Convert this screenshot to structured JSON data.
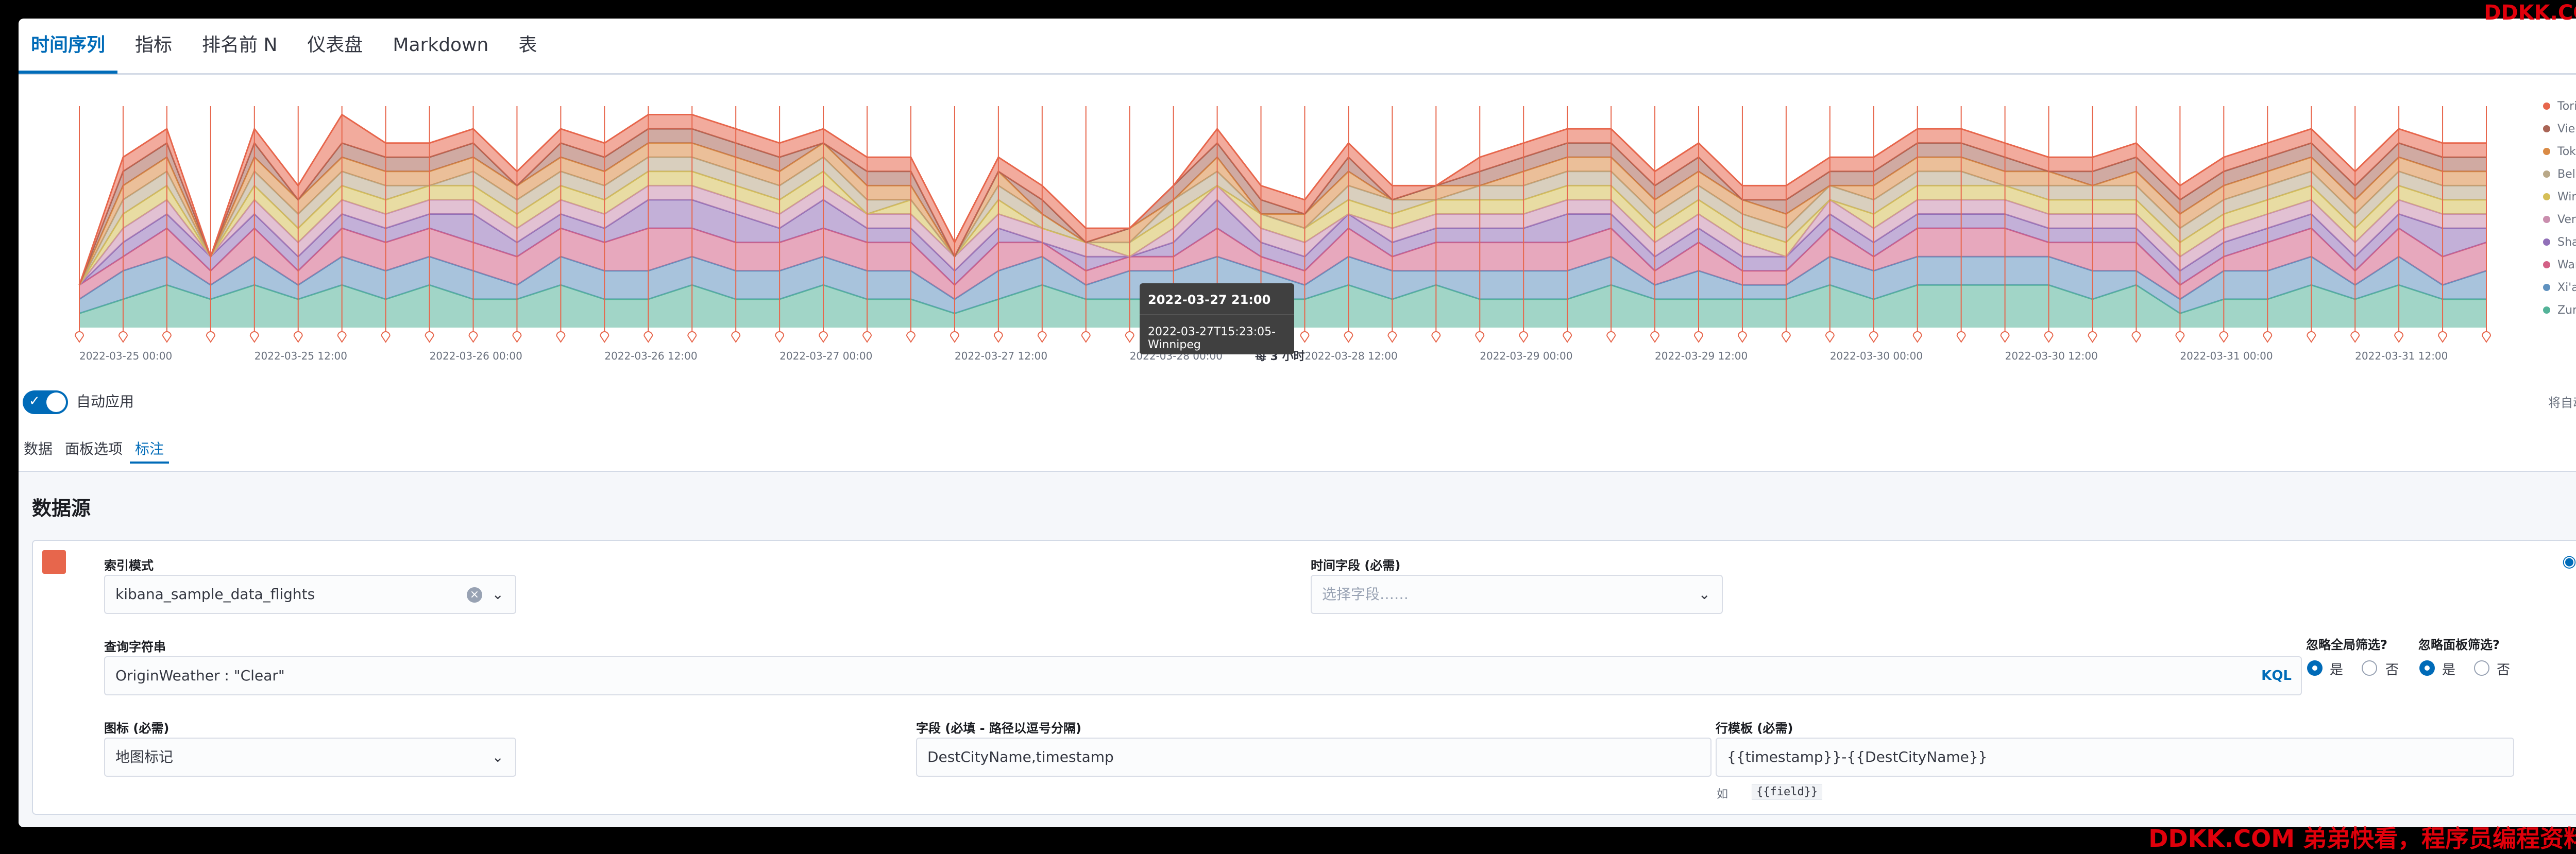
{
  "tabs": [
    {
      "label": "时间序列",
      "active": true
    },
    {
      "label": "指标",
      "active": false
    },
    {
      "label": "排名前 N",
      "active": false
    },
    {
      "label": "仪表盘",
      "active": false
    },
    {
      "label": "Markdown",
      "active": false
    },
    {
      "label": "表",
      "active": false
    }
  ],
  "chart_data": {
    "type": "area",
    "stacked": true,
    "x": [
      "2022-03-25 00:00",
      "2022-03-25 03:00",
      "2022-03-25 06:00",
      "2022-03-25 09:00",
      "2022-03-25 12:00",
      "2022-03-25 15:00",
      "2022-03-25 18:00",
      "2022-03-25 21:00",
      "2022-03-26 00:00",
      "2022-03-26 03:00",
      "2022-03-26 06:00",
      "2022-03-26 09:00",
      "2022-03-26 12:00",
      "2022-03-26 15:00",
      "2022-03-26 18:00",
      "2022-03-26 21:00",
      "2022-03-27 00:00",
      "2022-03-27 03:00",
      "2022-03-27 06:00",
      "2022-03-27 09:00",
      "2022-03-27 12:00",
      "2022-03-27 15:00",
      "2022-03-27 18:00",
      "2022-03-27 21:00",
      "2022-03-28 00:00",
      "2022-03-28 03:00",
      "2022-03-28 06:00",
      "2022-03-28 09:00",
      "2022-03-28 12:00",
      "2022-03-28 15:00",
      "2022-03-28 18:00",
      "2022-03-28 21:00",
      "2022-03-29 00:00",
      "2022-03-29 03:00",
      "2022-03-29 06:00",
      "2022-03-29 09:00",
      "2022-03-29 12:00",
      "2022-03-29 15:00",
      "2022-03-29 18:00",
      "2022-03-29 21:00",
      "2022-03-30 00:00",
      "2022-03-30 03:00",
      "2022-03-30 06:00",
      "2022-03-30 09:00",
      "2022-03-30 12:00",
      "2022-03-30 15:00",
      "2022-03-30 18:00",
      "2022-03-30 21:00",
      "2022-03-31 00:00",
      "2022-03-31 03:00",
      "2022-03-31 06:00",
      "2022-03-31 09:00",
      "2022-03-31 12:00",
      "2022-03-31 15:00",
      "2022-03-31 18:00",
      "2022-03-31 21:00"
    ],
    "x_ticks": [
      "2022-03-25 00:00",
      "2022-03-25 12:00",
      "2022-03-26 00:00",
      "2022-03-26 12:00",
      "2022-03-27 00:00",
      "2022-03-27 12:00",
      "2022-03-28 00:00",
      "2022-03-28 12:00",
      "2022-03-29 00:00",
      "2022-03-29 12:00",
      "2022-03-30 00:00",
      "2022-03-30 12:00",
      "2022-03-31 00:00",
      "2022-03-31 12:00"
    ],
    "xlabel": "每 3 小时",
    "series": [
      {
        "name": "Zurich",
        "color": "#54b399",
        "values": [
          1,
          2,
          3,
          2,
          3,
          2,
          3,
          2,
          3,
          2,
          2,
          3,
          2,
          2,
          3,
          2,
          2,
          3,
          2,
          2,
          1,
          2,
          3,
          2,
          2,
          2,
          3,
          2,
          2,
          3,
          2,
          3,
          2,
          2,
          2,
          3,
          2,
          2,
          2,
          2,
          3,
          2,
          3,
          3,
          3,
          3,
          2,
          3,
          1,
          2,
          2,
          3,
          2,
          3,
          2,
          2
        ]
      },
      {
        "name": "Xi'an",
        "color": "#6092c0",
        "values": [
          1,
          2,
          2,
          1,
          2,
          1,
          2,
          2,
          2,
          2,
          1,
          2,
          2,
          2,
          2,
          2,
          2,
          2,
          2,
          2,
          1,
          2,
          2,
          1,
          2,
          2,
          2,
          2,
          1,
          2,
          2,
          1,
          2,
          2,
          2,
          2,
          1,
          2,
          1,
          1,
          2,
          2,
          2,
          2,
          2,
          2,
          2,
          1,
          1,
          2,
          2,
          2,
          1,
          2,
          1,
          2
        ]
      },
      {
        "name": "Warsaw",
        "color": "#d36086",
        "values": [
          1,
          1,
          2,
          1,
          2,
          1,
          2,
          2,
          2,
          2,
          2,
          2,
          2,
          3,
          2,
          2,
          2,
          2,
          2,
          2,
          1,
          2,
          1,
          1,
          1,
          1,
          2,
          1,
          1,
          2,
          1,
          2,
          2,
          2,
          2,
          2,
          1,
          2,
          1,
          1,
          2,
          1,
          2,
          2,
          2,
          1,
          2,
          2,
          1,
          1,
          2,
          2,
          1,
          2,
          2,
          2
        ]
      },
      {
        "name": "Shanghai",
        "color": "#9170b8",
        "values": [
          0,
          1,
          1,
          1,
          1,
          1,
          1,
          1,
          1,
          2,
          1,
          1,
          1,
          2,
          2,
          2,
          1,
          2,
          1,
          1,
          1,
          1,
          0,
          1,
          0,
          1,
          2,
          1,
          1,
          1,
          1,
          1,
          1,
          1,
          2,
          1,
          1,
          1,
          1,
          1,
          1,
          1,
          1,
          1,
          1,
          1,
          1,
          1,
          1,
          1,
          1,
          1,
          1,
          1,
          2,
          1
        ]
      },
      {
        "name": "Verona",
        "color": "#ca8eae",
        "values": [
          0,
          1,
          1,
          0,
          1,
          1,
          1,
          1,
          1,
          1,
          1,
          1,
          1,
          1,
          1,
          1,
          1,
          1,
          1,
          1,
          1,
          1,
          1,
          1,
          0,
          1,
          1,
          1,
          1,
          0,
          1,
          1,
          1,
          1,
          1,
          1,
          1,
          1,
          1,
          0,
          1,
          1,
          1,
          1,
          1,
          1,
          1,
          1,
          1,
          1,
          1,
          1,
          1,
          1,
          1,
          1
        ]
      },
      {
        "name": "Winnipeg",
        "color": "#d6bf57",
        "values": [
          0,
          1,
          1,
          0,
          1,
          1,
          1,
          1,
          1,
          1,
          1,
          1,
          1,
          1,
          1,
          1,
          1,
          1,
          0,
          1,
          0,
          1,
          0,
          0,
          1,
          1,
          0,
          1,
          1,
          1,
          1,
          1,
          1,
          1,
          1,
          1,
          1,
          1,
          1,
          1,
          0,
          1,
          1,
          1,
          1,
          1,
          1,
          1,
          1,
          1,
          1,
          1,
          1,
          1,
          1,
          1
        ]
      },
      {
        "name": "Belograd",
        "color": "#b9a888",
        "values": [
          0,
          1,
          1,
          0,
          1,
          1,
          1,
          1,
          0,
          1,
          1,
          1,
          1,
          1,
          1,
          1,
          1,
          1,
          1,
          0,
          0,
          1,
          1,
          0,
          0,
          1,
          1,
          0,
          0,
          1,
          1,
          0,
          1,
          1,
          1,
          1,
          1,
          1,
          1,
          1,
          1,
          1,
          1,
          1,
          0,
          1,
          1,
          1,
          1,
          1,
          1,
          1,
          1,
          1,
          1,
          1
        ]
      },
      {
        "name": "Tokyo",
        "color": "#da8b45",
        "values": [
          0,
          1,
          1,
          0,
          1,
          1,
          1,
          1,
          1,
          1,
          1,
          1,
          1,
          1,
          1,
          1,
          1,
          1,
          1,
          1,
          0,
          1,
          0,
          0,
          1,
          0,
          1,
          0,
          1,
          1,
          0,
          1,
          0,
          1,
          1,
          1,
          1,
          1,
          1,
          1,
          0,
          1,
          1,
          1,
          1,
          1,
          0,
          1,
          1,
          1,
          1,
          1,
          1,
          1,
          1,
          1
        ]
      },
      {
        "name": "Vienna",
        "color": "#aa6556",
        "values": [
          0,
          1,
          1,
          0,
          1,
          0,
          1,
          1,
          1,
          1,
          0,
          1,
          1,
          1,
          1,
          1,
          1,
          0,
          1,
          1,
          0,
          0,
          1,
          0,
          0,
          1,
          1,
          1,
          0,
          1,
          0,
          0,
          1,
          1,
          1,
          1,
          1,
          1,
          0,
          1,
          1,
          1,
          1,
          1,
          1,
          0,
          1,
          1,
          1,
          1,
          1,
          1,
          1,
          1,
          1,
          1
        ]
      },
      {
        "name": "Torino",
        "color": "#e7664c",
        "values": [
          0,
          1,
          1,
          0,
          1,
          1,
          2,
          1,
          1,
          1,
          1,
          1,
          1,
          1,
          1,
          1,
          1,
          1,
          1,
          1,
          1,
          1,
          1,
          1,
          0,
          0,
          1,
          1,
          1,
          1,
          1,
          0,
          1,
          1,
          1,
          1,
          1,
          1,
          1,
          1,
          1,
          1,
          1,
          1,
          1,
          1,
          1,
          1,
          1,
          1,
          1,
          1,
          1,
          1,
          1,
          1
        ]
      }
    ],
    "annotation_color": "#e7664c",
    "legend_position": "right",
    "grid": false
  },
  "tooltip": {
    "time": "2022-03-27 21:00",
    "text": "2022-03-27T15:23:05-Winnipeg"
  },
  "auto_apply": {
    "label": "自动应用",
    "enabled": true,
    "hint": "将自动应"
  },
  "subtabs": [
    {
      "label": "数据",
      "active": false
    },
    {
      "label": "面板选项",
      "active": false
    },
    {
      "label": "标注",
      "active": true
    }
  ],
  "annotations": {
    "section_title": "数据源",
    "swatch_color": "#e7664c",
    "index_pattern": {
      "label": "索引模式",
      "value": "kibana_sample_data_flights"
    },
    "time_field": {
      "label": "时间字段 (必需)",
      "placeholder": "选择字段……"
    },
    "query": {
      "label": "查询字符串",
      "value": "OriginWeather : \"Clear\"",
      "language": "KQL"
    },
    "ignore_global": {
      "label": "忽略全局筛选?",
      "yes": "是",
      "no": "否",
      "value": "yes"
    },
    "ignore_panel": {
      "label": "忽略面板筛选?",
      "yes": "是",
      "no": "否",
      "value": "yes"
    },
    "icon": {
      "label": "图标 (必需)",
      "value": "地图标记"
    },
    "fields": {
      "label": "字段 (必填 - 路径以逗号分隔)",
      "value": "DestCityName,timestamp"
    },
    "row_template": {
      "label": "行模板 (必需)",
      "value": "{{timestamp}}-{{DestCityName}}",
      "help_prefix": "如",
      "help_code": "{{field}}"
    }
  },
  "watermark": {
    "top": "DDKK.COM",
    "bottom": "DDKK.COM 弟弟快看，程序员编程资料站"
  }
}
